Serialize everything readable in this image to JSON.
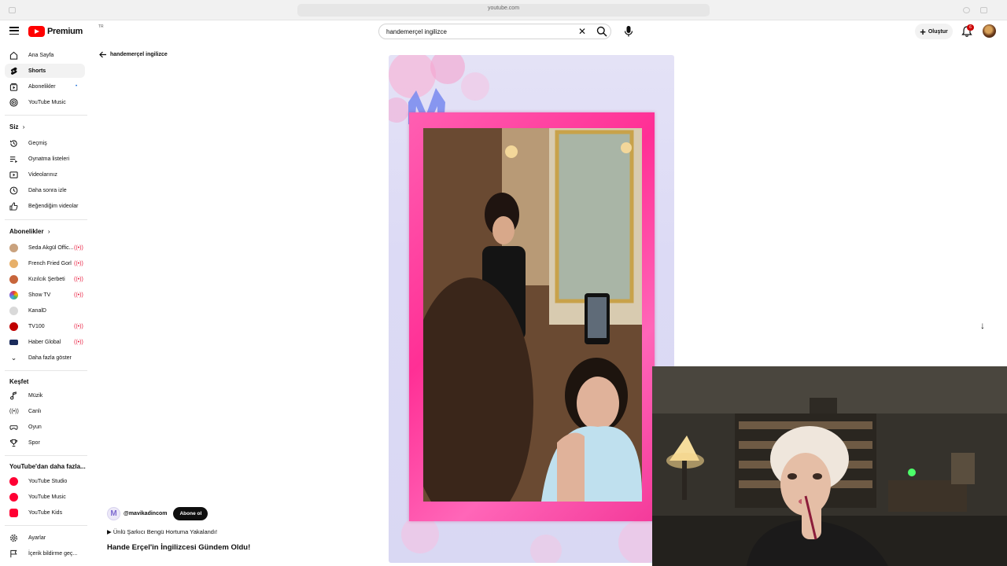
{
  "browser": {
    "url": "youtube.com"
  },
  "header": {
    "logo_text": "Premium",
    "logo_country": "TR",
    "search_value": "handemerçel ingilizce",
    "create_label": "Oluştur",
    "notification_count": "6"
  },
  "sidebar": {
    "main": [
      {
        "label": "Ana Sayfa",
        "icon": "home-icon"
      },
      {
        "label": "Shorts",
        "icon": "shorts-icon"
      },
      {
        "label": "Abonelikler",
        "icon": "subscriptions-icon"
      },
      {
        "label": "YouTube Music",
        "icon": "youtube-music-icon"
      }
    ],
    "you_heading": "Siz",
    "you": [
      {
        "label": "Geçmiş",
        "icon": "history-icon"
      },
      {
        "label": "Oynatma listeleri",
        "icon": "playlists-icon"
      },
      {
        "label": "Videolarınız",
        "icon": "your-videos-icon"
      },
      {
        "label": "Daha sonra izle",
        "icon": "watch-later-icon"
      },
      {
        "label": "Beğendiğim videolar",
        "icon": "liked-icon"
      }
    ],
    "subs_heading": "Abonelikler",
    "subscriptions": [
      {
        "label": "Seda Akgül Offic...",
        "color": "#c9a27e"
      },
      {
        "label": "French Fried Gorl",
        "color": "#e7b06a"
      },
      {
        "label": "Kızılcık Şerbeti",
        "color": "#c7653b"
      },
      {
        "label": "Show TV",
        "color": "#3fa9e0"
      },
      {
        "label": "KanalD",
        "color": "#8a8a8a"
      },
      {
        "label": "TV100",
        "color": "#c00000"
      },
      {
        "label": "Haber Global",
        "color": "#1b2c5c"
      }
    ],
    "show_more_label": "Daha fazla göster",
    "explore_heading": "Keşfet",
    "explore": [
      {
        "label": "Müzik",
        "icon": "music-icon"
      },
      {
        "label": "Canlı",
        "icon": "live-icon"
      },
      {
        "label": "Oyun",
        "icon": "gaming-icon"
      },
      {
        "label": "Spor",
        "icon": "trophy-icon"
      }
    ],
    "more_heading": "YouTube'dan daha fazla...",
    "more": [
      {
        "label": "YouTube Studio"
      },
      {
        "label": "YouTube Music"
      },
      {
        "label": "YouTube Kids"
      }
    ],
    "bottom": [
      {
        "label": "Ayarlar",
        "icon": "settings-icon"
      },
      {
        "label": "İçerik bildirme geç...",
        "icon": "flag-icon"
      }
    ]
  },
  "main": {
    "back_label": "handemerçel ingilizce",
    "channel_handle": "@mavikadincom",
    "channel_avatar_letter": "M",
    "subscribe_label": "Abone ol",
    "sound_text": "▶ Ünlü Şarkıcı Bengü Hortuma Yakalandı!",
    "video_title": "Hande Erçel'in İngilizcesi Gündem Oldu!"
  },
  "colors": {
    "accent": "#ff0000",
    "frame_pink": "#ff3d9e",
    "frame_bg": "#dcdaf5"
  }
}
